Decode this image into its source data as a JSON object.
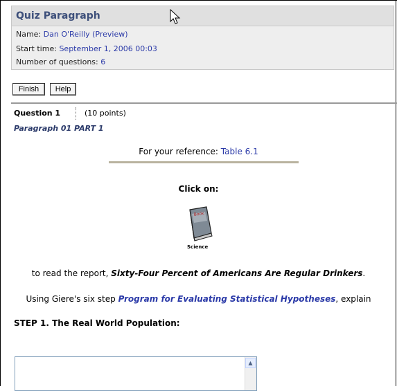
{
  "quiz": {
    "title": "Quiz Paragraph",
    "name_label": "Name: ",
    "name_value": "Dan O'Reilly (Preview)",
    "start_label": "Start time: ",
    "start_value": "September 1, 2006 00:03",
    "count_label": "Number of questions: ",
    "count_value": "6"
  },
  "toolbar": {
    "finish_label": "Finish",
    "help_label": "Help"
  },
  "question": {
    "label": "Question 1",
    "points": "(10 points)",
    "subtitle": "Paragraph 01 PART 1",
    "reference_prefix": "For your reference: ",
    "reference_link": "Table 6.1",
    "click_on": "Click on:",
    "icon_caption": "Science",
    "book_label": "Book",
    "report_prefix": "to read the report, ",
    "report_title": "Sixty-Four Percent of Americans Are Regular Drinkers",
    "report_suffix": ".",
    "giere_prefix": "Using Giere's six step ",
    "giere_link": "Program for Evaluating Statistical Hypotheses",
    "giere_suffix": ", explain",
    "step_label": "STEP 1. The Real World Population:"
  },
  "answer": {
    "value": ""
  }
}
